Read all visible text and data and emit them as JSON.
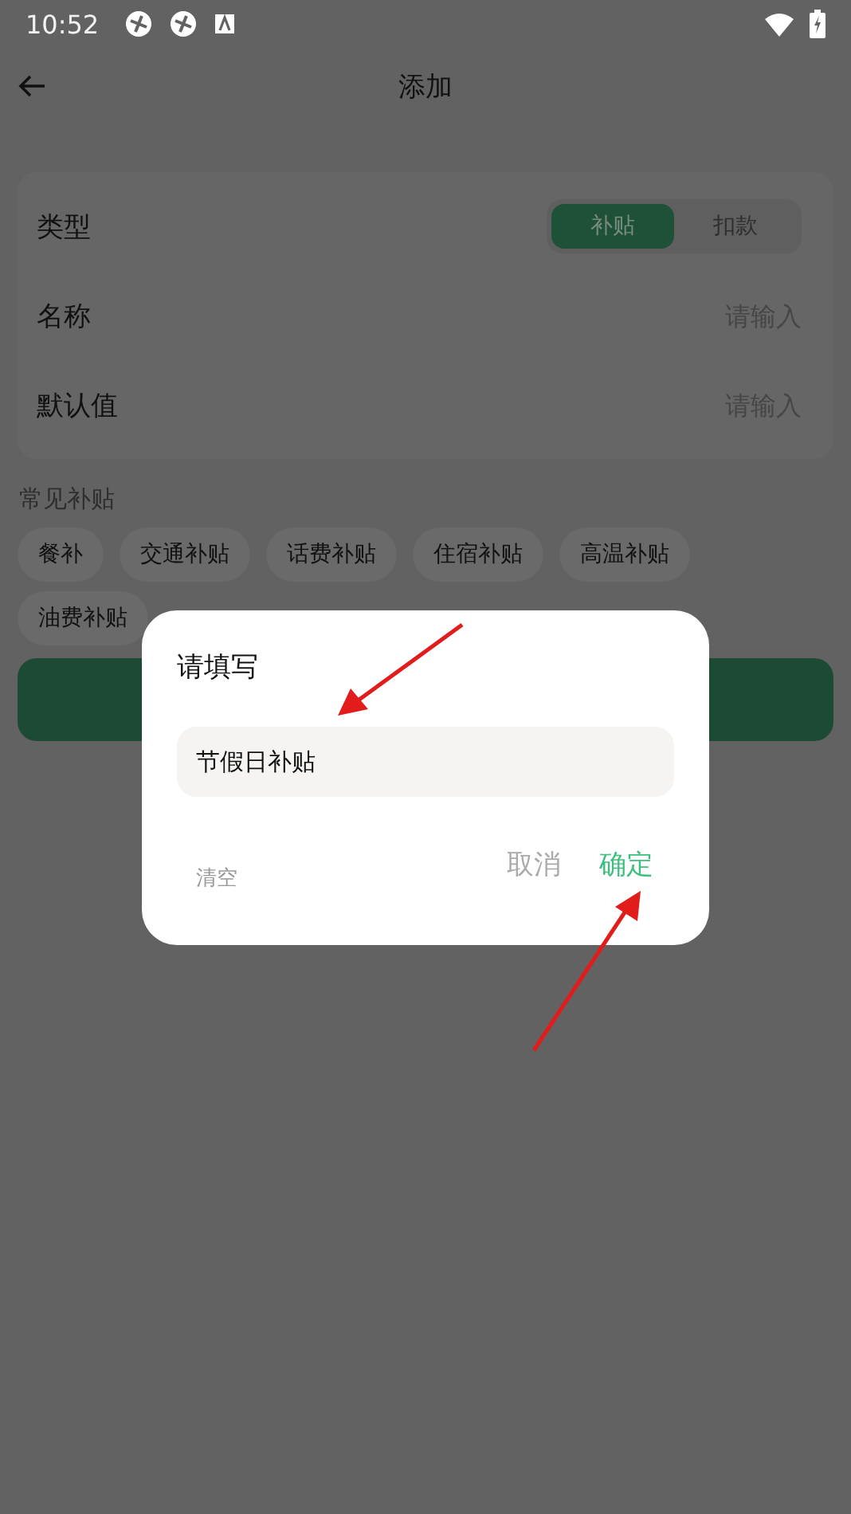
{
  "status_bar": {
    "time": "10:52"
  },
  "header": {
    "title": "添加"
  },
  "form": {
    "type_label": "类型",
    "segments": [
      {
        "label": "补贴",
        "selected": true
      },
      {
        "label": "扣款",
        "selected": false
      }
    ],
    "fields": [
      {
        "label": "名称",
        "placeholder": "请输入"
      },
      {
        "label": "默认值",
        "placeholder": "请输入"
      }
    ]
  },
  "common": {
    "title": "常见补贴",
    "chips": [
      "餐补",
      "交通补贴",
      "话费补贴",
      "住宿补贴",
      "高温补贴",
      "油费补贴"
    ]
  },
  "dialog": {
    "title": "请填写",
    "value": "节假日补贴",
    "clear": "清空",
    "cancel": "取消",
    "confirm": "确定"
  }
}
